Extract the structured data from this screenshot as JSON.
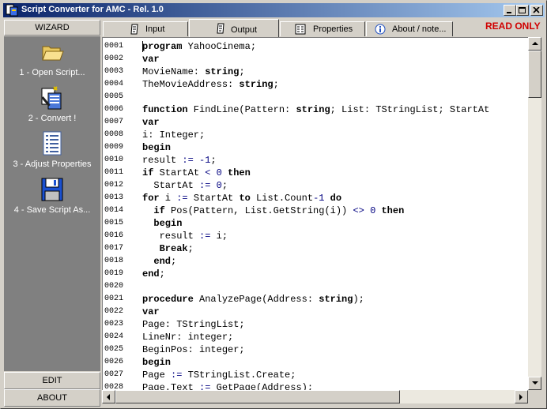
{
  "window": {
    "title": "Script Converter for AMC - Rel. 1.0"
  },
  "sidebar": {
    "header": "WIZARD",
    "tools": [
      {
        "label": "1 - Open Script...",
        "icon": "folder-icon"
      },
      {
        "label": "2 - Convert !",
        "icon": "convert-icon"
      },
      {
        "label": "3 - Adjust Properties",
        "icon": "document-list-icon"
      },
      {
        "label": "4 - Save Script As...",
        "icon": "floppy-disk-icon"
      }
    ],
    "edit_label": "EDIT",
    "about_label": "ABOUT"
  },
  "tabs": [
    {
      "label": "Input",
      "icon": "script-icon",
      "active": false
    },
    {
      "label": "Output",
      "icon": "script-icon",
      "active": true
    },
    {
      "label": "Properties",
      "icon": "properties-icon",
      "active": false
    },
    {
      "label": "About / note...",
      "icon": "info-icon",
      "active": false
    }
  ],
  "status": {
    "readonly_label": "READ ONLY",
    "readonly_color": "#d00000"
  },
  "editor": {
    "line_numbers": [
      "0001",
      "0002",
      "0003",
      "0004",
      "0005",
      "0006",
      "0007",
      "0008",
      "0009",
      "0010",
      "0011",
      "0012",
      "0013",
      "0014",
      "0015",
      "0016",
      "0017",
      "0018",
      "0019",
      "0020",
      "0021",
      "0022",
      "0023",
      "0024",
      "0025",
      "0026",
      "0027",
      "0028"
    ],
    "lines": [
      "program YahooCinema;",
      "var",
      "MovieName: string;",
      "TheMovieAddress: string;",
      "",
      "function FindLine(Pattern: string; List: TStringList; StartAt",
      "var",
      "i: Integer;",
      "begin",
      "result := -1;",
      "if StartAt < 0 then",
      "  StartAt := 0;",
      "for i := StartAt to List.Count-1 do",
      "  if Pos(Pattern, List.GetString(i)) <> 0 then",
      "  begin",
      "   result := i;",
      "   Break;",
      "  end;",
      "end;",
      "",
      "procedure AnalyzePage(Address: string);",
      "var",
      "Page: TStringList;",
      "LineNr: integer;",
      "BeginPos: integer;",
      "begin",
      "Page := TStringList.Create;",
      "Page.Text := GetPage(Address);"
    ]
  }
}
